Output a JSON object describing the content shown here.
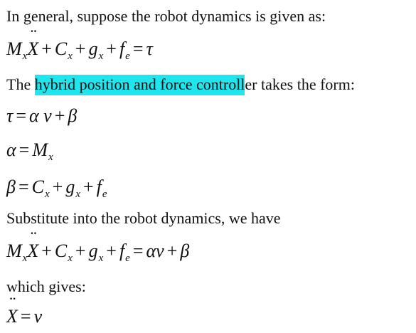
{
  "intro": "In general, suppose the robot dynamics is given as:",
  "eq1": {
    "M": "M",
    "Msub": "x",
    "X": "X",
    "plus1": "+",
    "C": "C",
    "Csub": "x",
    "plus2": "+",
    "g": "g",
    "gsub": "x",
    "plus3": "+",
    "f": "f",
    "fsub": "e",
    "eq": "=",
    "tau": "τ"
  },
  "controller_line": {
    "before": "The ",
    "highlight": "hybrid position and force controll",
    "after": "er takes the form:",
    "highlight_color": "#1ee5ee"
  },
  "eq2": {
    "tau": "τ",
    "eq": "=",
    "alpha": "α",
    "v": "v",
    "plus": "+",
    "beta": "β"
  },
  "eq3": {
    "alpha": "α",
    "eq": "=",
    "M": "M",
    "Msub": "x"
  },
  "eq4": {
    "beta": "β",
    "eq": "=",
    "C": "C",
    "Csub": "x",
    "plus1": "+",
    "g": "g",
    "gsub": "x",
    "plus2": "+",
    "f": "f",
    "fsub": "e"
  },
  "substitute": "Substitute into the robot dynamics, we have",
  "eq5": {
    "M": "M",
    "Msub": "x",
    "X": "X",
    "plus1": "+",
    "C": "C",
    "Csub": "x",
    "plus2": "+",
    "g": "g",
    "gsub": "x",
    "plus3": "+",
    "f": "f",
    "fsub": "e",
    "eq": "=",
    "alphav": "αv",
    "plus4": "+",
    "beta": "β"
  },
  "gives": "which gives:",
  "eq6": {
    "X": "X",
    "eq": "=",
    "v": "v"
  }
}
